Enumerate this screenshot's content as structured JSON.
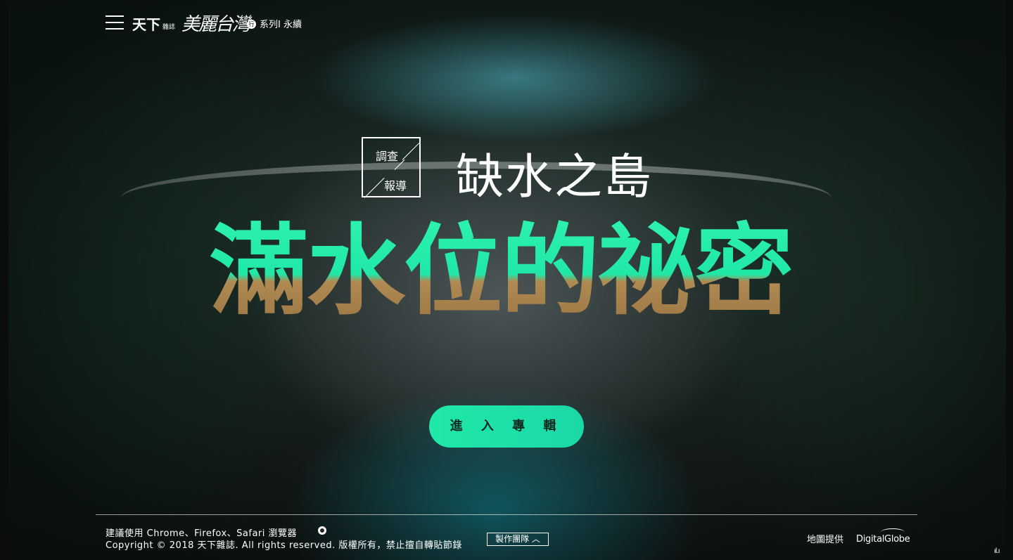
{
  "header": {
    "logo_main": "天下",
    "logo_sub": "雜誌",
    "series_logo": "美麗台灣",
    "series_badge": "行",
    "series_text": "系列Ⅰ 永續"
  },
  "hero": {
    "report_badge_line1": "調查",
    "report_badge_line2": "報導",
    "subtitle": "缺水之島",
    "title": "滿水位的祕密",
    "enter_button": "進 入 專 輯"
  },
  "footer": {
    "browser_note": "建議使用 Chrome、Firefox、Safari 瀏覽器",
    "copyright": "Copyright © 2018 天下雜誌. All rights reserved. 版權所有，禁止擅自轉貼節錄",
    "team_button": "製作團隊 ︿",
    "map_credit": "地圖提供",
    "provider_logo": "DigitalGlobe",
    "corner_icon": "ıl.ı"
  },
  "colors": {
    "accent": "#1fe8a8",
    "title_top": "#2ef2b0",
    "title_bottom": "#9a7442"
  },
  "icons": [
    "menu-icon",
    "github-icon"
  ]
}
